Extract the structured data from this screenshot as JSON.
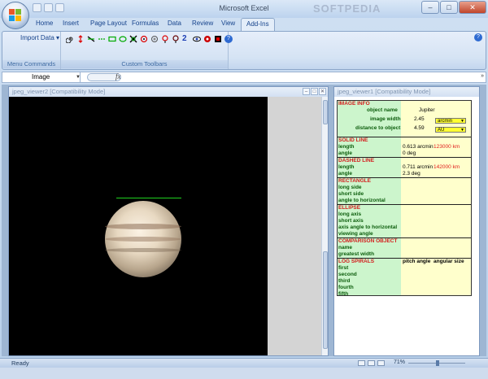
{
  "window": {
    "title": "Microsoft Excel",
    "watermark": "SOFTPEDIA"
  },
  "tabs": [
    "Home",
    "Insert",
    "Page Layout",
    "Formulas",
    "Data",
    "Review",
    "View",
    "Add-Ins"
  ],
  "active_tab": "Add-Ins",
  "ribbon": {
    "import_label": "Import Data",
    "group_menu": "Menu Commands",
    "group_custom": "Custom Toolbars",
    "tool_number": "2"
  },
  "formulabar": {
    "namebox": "Image",
    "fx": "fx"
  },
  "viewer2": {
    "title": "jpeg_viewer2  [Compatibility Mode]"
  },
  "viewer1": {
    "title": "jpeg_viewer1  [Compatibility Mode]"
  },
  "info": {
    "image_info": {
      "head": "IMAGE INFO",
      "object_name_label": "object name",
      "object_name": "Jupiter",
      "image_width_label": "image width",
      "image_width": "2.45",
      "image_width_unit": "arcmin",
      "distance_label": "distance to object",
      "distance": "4.59",
      "distance_unit": "AU"
    },
    "solid": {
      "head": "SOLID LINE",
      "length_label": "length",
      "angle_label": "angle",
      "length": "0.613 arcmin",
      "length_km": "123000 km",
      "angle": "0 deg"
    },
    "dashed": {
      "head": "DASHED LINE",
      "length_label": "length",
      "angle_label": "angle",
      "length": "0.711 arcmin",
      "length_km": "142000 km",
      "angle": "2.3 deg"
    },
    "rectangle": {
      "head": "RECTANGLE",
      "long": "long side",
      "short": "short side",
      "angle": "angle to horizontal"
    },
    "ellipse": {
      "head": "ELLIPSE",
      "long": "long axis",
      "short": "short axis",
      "axis_angle": "axis angle to horizontal",
      "viewing": "viewing angle"
    },
    "comparison": {
      "head": "COMPARISON OBJECT",
      "name": "name",
      "width": "greatest width"
    },
    "spirals": {
      "head": "LOG SPIRALS",
      "pitch": "pitch angle",
      "angular": "angular size",
      "first": "first",
      "second": "second",
      "third": "third",
      "fourth": "fourth",
      "fifth": "fifth"
    }
  },
  "status": {
    "ready": "Ready",
    "zoom": "71%"
  },
  "colors": {
    "label_green": "#0b5c0b",
    "head_red": "#d41c1c",
    "cell_green": "#ccf5cc",
    "cell_yellow": "#ffffcc"
  }
}
